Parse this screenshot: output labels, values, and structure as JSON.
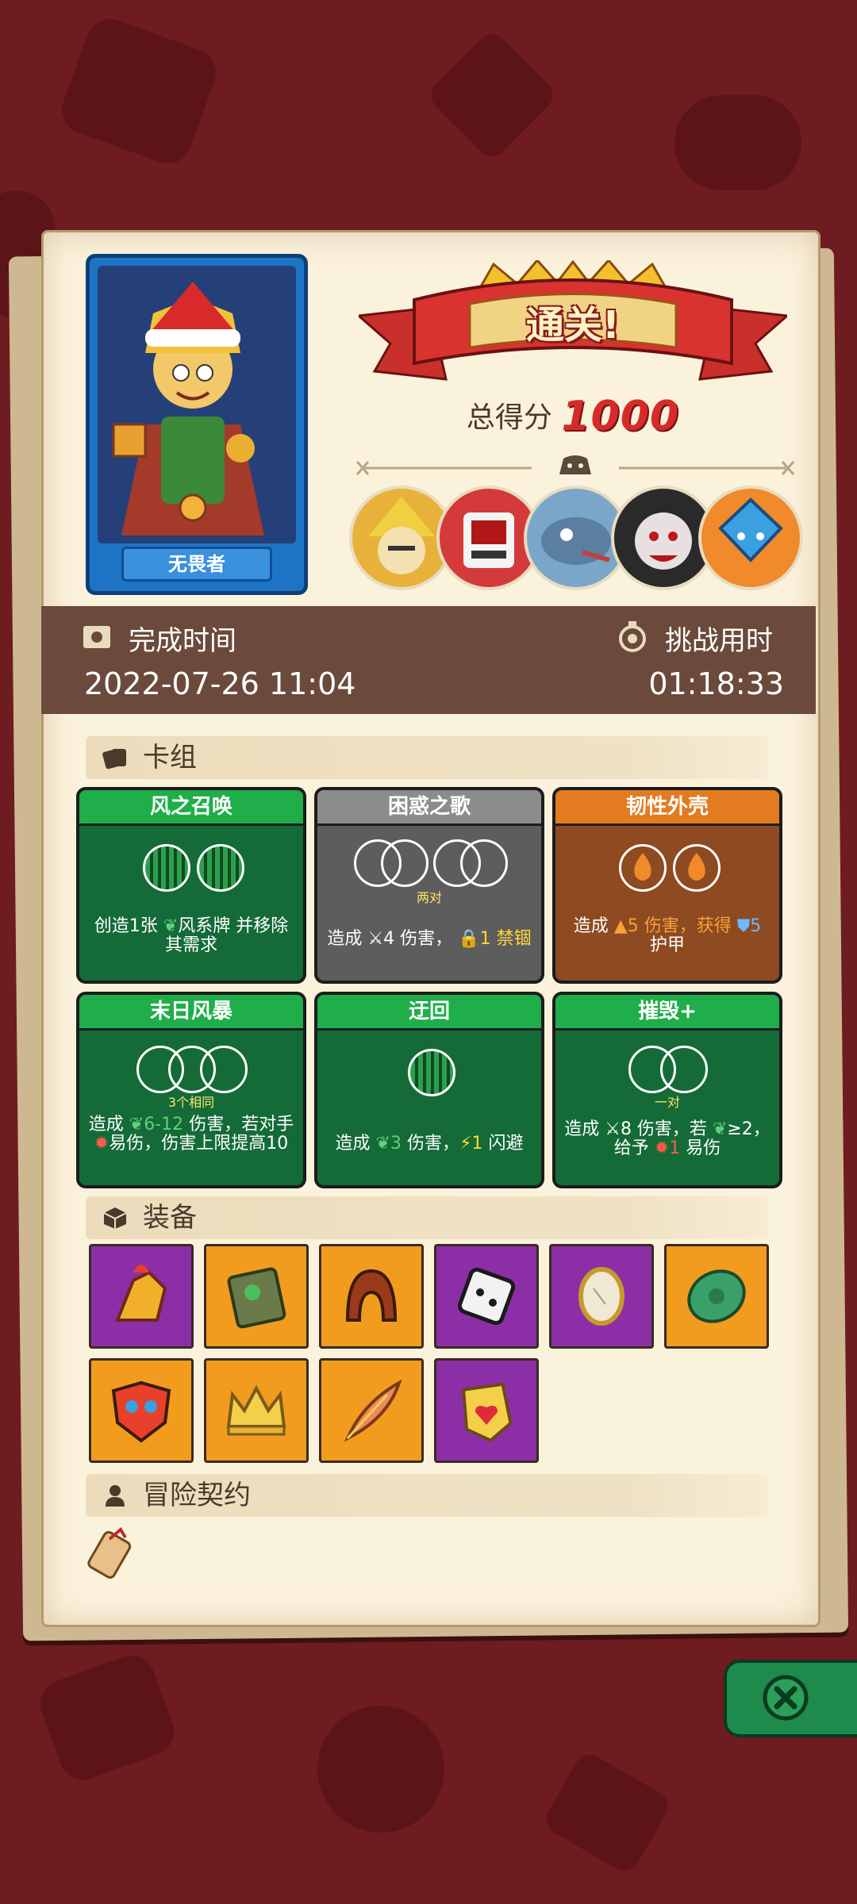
{
  "hero": {
    "name": "无畏者"
  },
  "result": {
    "banner": "通关!",
    "score_label": "总得分",
    "score": "1000"
  },
  "info": {
    "finish_label": "完成时间",
    "finish_value": "2022-07-26 11:04",
    "duration_label": "挑战用时",
    "duration_value": "01:18:33"
  },
  "deck": {
    "title": "卡组",
    "cards": [
      {
        "name": "风之召唤",
        "sub": "",
        "desc_a": "创造1张",
        "desc_b": "风系牌 并移除其需求",
        "color": "green"
      },
      {
        "name": "困惑之歌",
        "sub": "两对",
        "desc_a": "造成",
        "desc_b": "4 伤害，",
        "desc_c": "1 禁锢",
        "color": "grey"
      },
      {
        "name": "韧性外壳",
        "sub": "",
        "desc_a": "造成",
        "desc_b": "5 伤害，获得",
        "desc_c": "5",
        "desc_d": "护甲",
        "color": "orange"
      },
      {
        "name": "末日风暴",
        "sub": "3个相同",
        "desc_a": "造成",
        "desc_b": "6-12",
        "desc_c": "伤害，若对手",
        "desc_d": "易伤，伤害上限提高10",
        "color": "green"
      },
      {
        "name": "迂回",
        "sub": "",
        "desc_a": "造成",
        "desc_b": "3",
        "desc_c": "伤害，",
        "desc_d": "1",
        "desc_e": "闪避",
        "color": "green"
      },
      {
        "name": "摧毁+",
        "sub": "一对",
        "desc_a": "造成",
        "desc_b": "8 伤害，若",
        "desc_c": "≥2，给予",
        "desc_d": "1",
        "desc_e": "易伤",
        "color": "green"
      }
    ]
  },
  "equipment": {
    "title": "装备",
    "items": [
      {
        "icon": "flame-gauntlet-icon",
        "rarity": "purple"
      },
      {
        "icon": "moss-block-icon",
        "rarity": "orange"
      },
      {
        "icon": "leather-hood-icon",
        "rarity": "orange"
      },
      {
        "icon": "cracked-die-icon",
        "rarity": "purple"
      },
      {
        "icon": "mirror-icon",
        "rarity": "purple"
      },
      {
        "icon": "turtle-shell-icon",
        "rarity": "orange"
      },
      {
        "icon": "tribal-mask-icon",
        "rarity": "orange"
      },
      {
        "icon": "gold-crown-icon",
        "rarity": "orange"
      },
      {
        "icon": "phoenix-feather-icon",
        "rarity": "orange"
      },
      {
        "icon": "heart-shield-icon",
        "rarity": "purple"
      }
    ]
  },
  "contract": {
    "title": "冒险契约",
    "icon": "scroll-icon"
  },
  "colors": {
    "paper": "#fbf2dc",
    "band": "#6b4a3c",
    "background": "#6e1c1f",
    "score": "#d62b2b"
  }
}
